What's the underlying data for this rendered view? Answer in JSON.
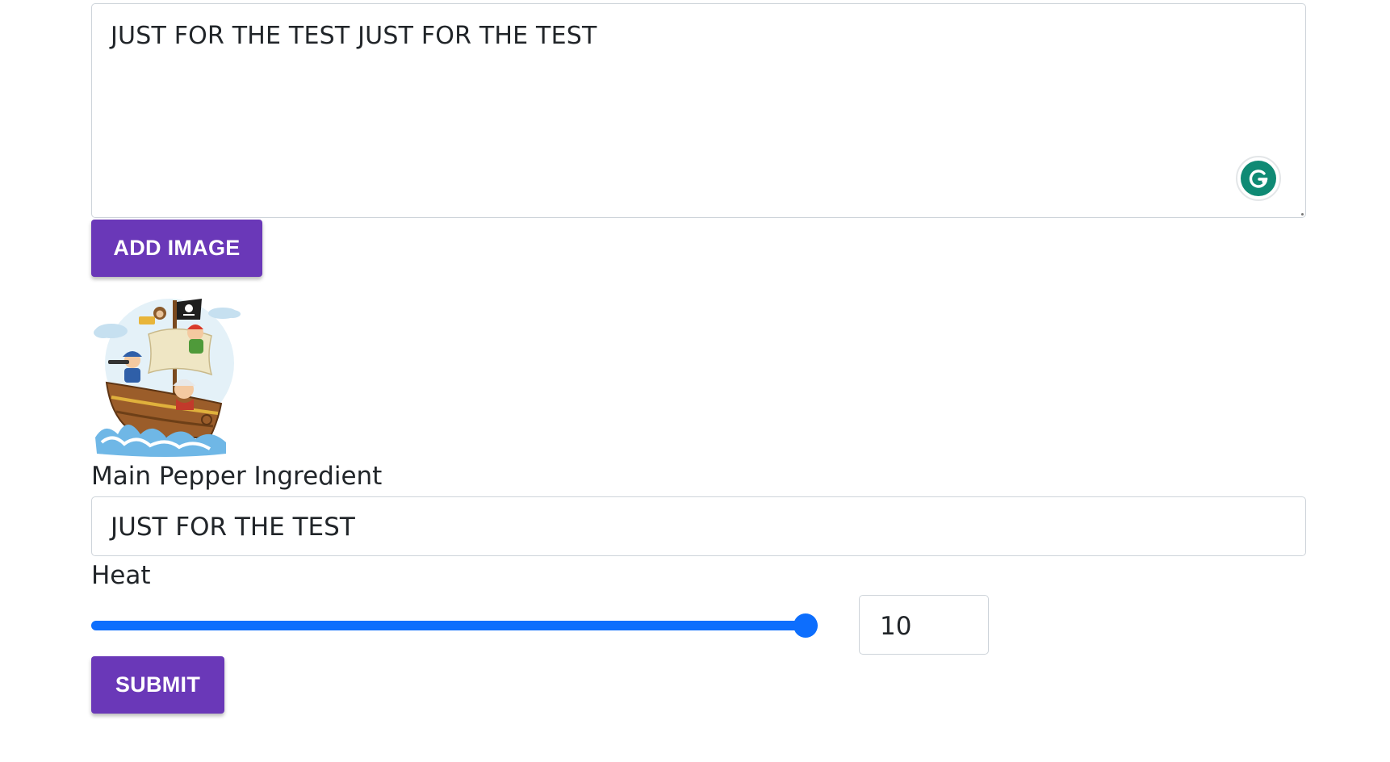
{
  "description": {
    "value": "JUST FOR THE TEST JUST FOR THE TEST",
    "assistant_icon": "grammarly-icon"
  },
  "add_image_button": {
    "label": "ADD IMAGE"
  },
  "uploaded_image": {
    "icon": "pirate-ship-illustration"
  },
  "pepper": {
    "label": "Main Pepper Ingredient",
    "value": "JUST FOR THE TEST"
  },
  "heat": {
    "label": "Heat",
    "value": "10",
    "slider_fraction": 1.0
  },
  "submit_button": {
    "label": "SUBMIT"
  },
  "colors": {
    "button": "#6a38b8",
    "slider": "#0d6efd",
    "grammarly": "#0f8a74"
  }
}
